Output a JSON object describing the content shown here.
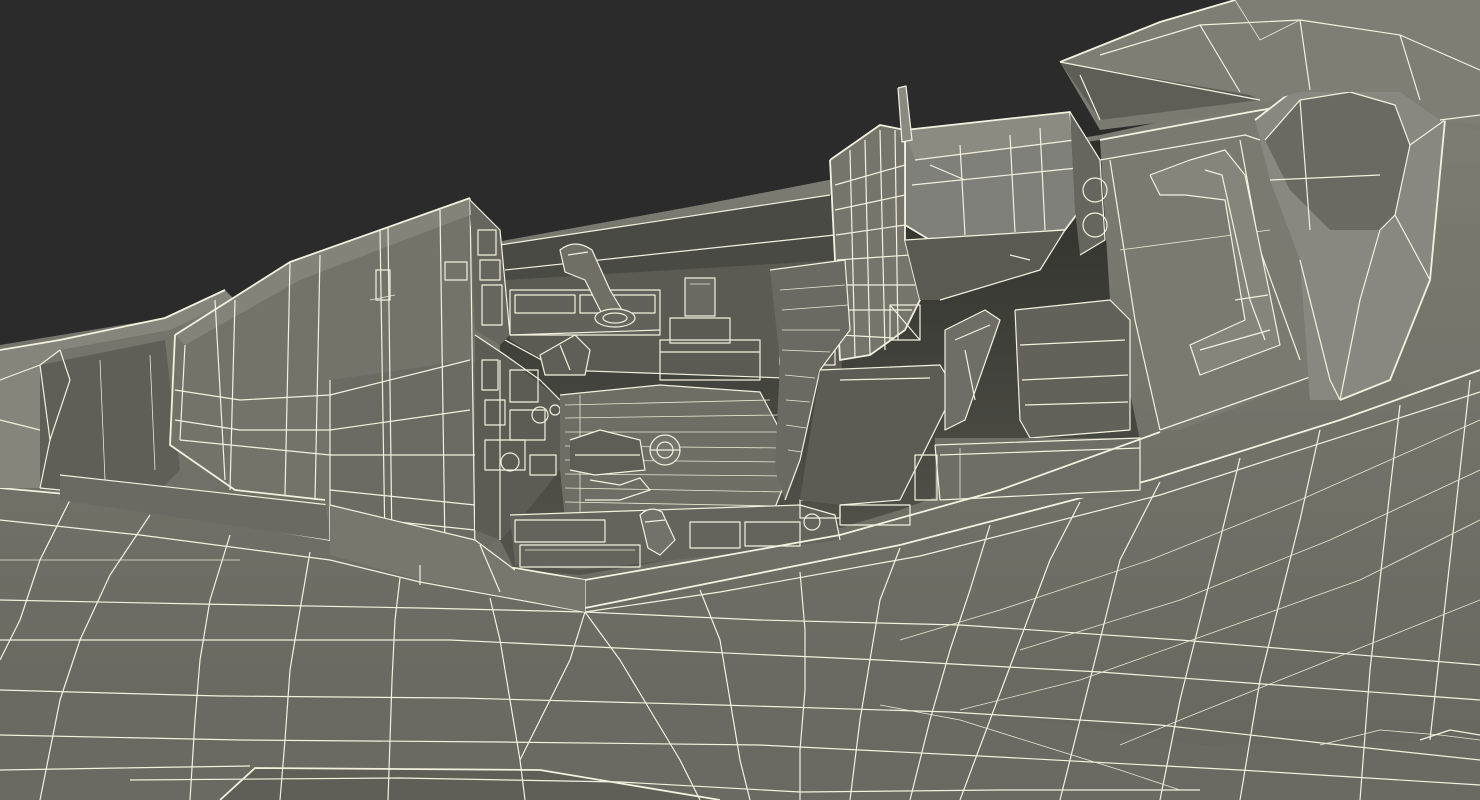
{
  "viewport": {
    "background_color": "#2b2b2b",
    "shading": {
      "hull_light": "#7b7b71",
      "hull_mid": "#6d6d64",
      "hull_dark": "#55554d",
      "cockpit_shadow": "#3a3a35",
      "wire_color": "#f3f1de"
    }
  },
  "model": {
    "components": [
      {
        "id": "fuselage",
        "icon": "fuselage-wireframe"
      },
      {
        "id": "cockpit-rim",
        "icon": "cockpit-rim-wireframe"
      },
      {
        "id": "forward-intake",
        "icon": "intake-wireframe"
      },
      {
        "id": "instrument-panel",
        "icon": "instrument-panel-wireframe"
      },
      {
        "id": "control-stick",
        "icon": "control-stick-wireframe"
      },
      {
        "id": "ejection-seat",
        "icon": "ejection-seat-wireframe"
      },
      {
        "id": "rear-console",
        "icon": "console-wireframe"
      },
      {
        "id": "canopy-frame",
        "icon": "canopy-frame-wireframe"
      }
    ]
  }
}
